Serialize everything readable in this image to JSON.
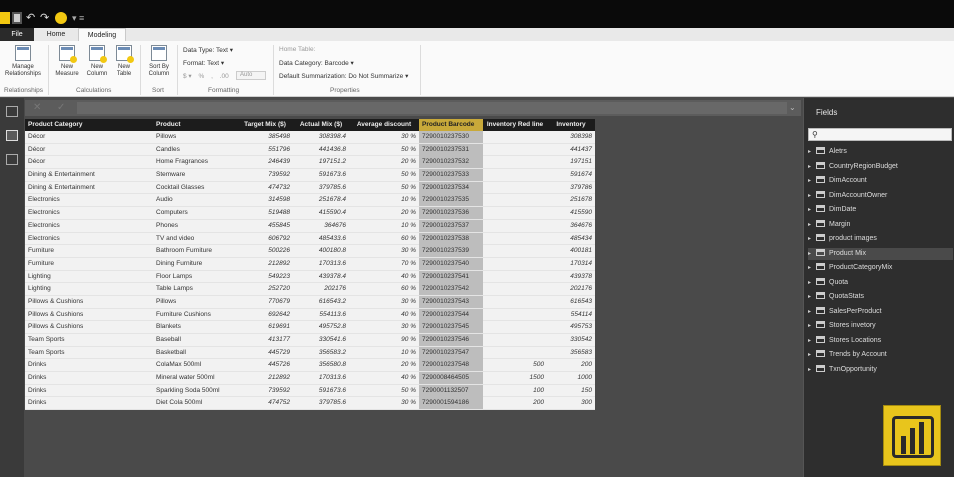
{
  "tabs": {
    "file": "File",
    "home": "Home",
    "modeling": "Modeling"
  },
  "ribbon": {
    "manage_relationships": "Manage Relationships",
    "relationships_group": "Relationships",
    "new_measure": "New Measure",
    "new_column": "New Column",
    "new_table": "New Table",
    "calculations_group": "Calculations",
    "sort_by_column": "Sort By Column",
    "sort_group": "Sort",
    "data_type": "Data Type: Text",
    "format": "Format: Text",
    "currency_symbol": "$",
    "percent_symbol": "%",
    "comma_symbol": ",",
    "auto": "Auto",
    "formatting_group": "Formatting",
    "home_table": "Home Table:",
    "data_category": "Data Category: Barcode",
    "default_summarization": "Default Summarization: Do Not Summarize",
    "properties_group": "Properties"
  },
  "icons": {
    "close": "close-icon",
    "check": "check-icon",
    "expand": "chevron-down-icon",
    "search": "search-icon",
    "table": "table-icon"
  },
  "table": {
    "columns": [
      "Product Category",
      "Product",
      "Target Mix ($)",
      "Actual Mix ($)",
      "Average discount",
      "Product Barcode",
      "Inventory Red line",
      "Inventory"
    ],
    "rows": [
      [
        "Décor",
        "Pillows",
        "385498",
        "308398.4",
        "30 %",
        "7290010237530",
        "",
        "308398"
      ],
      [
        "Décor",
        "Candles",
        "551796",
        "441436.8",
        "50 %",
        "7290010237531",
        "",
        "441437"
      ],
      [
        "Décor",
        "Home Fragrances",
        "246439",
        "197151.2",
        "20 %",
        "7290010237532",
        "",
        "197151"
      ],
      [
        "Dining & Entertainment",
        "Stemware",
        "739592",
        "591673.6",
        "50 %",
        "7290010237533",
        "",
        "591674"
      ],
      [
        "Dining & Entertainment",
        "Cocktail Glasses",
        "474732",
        "379785.6",
        "50 %",
        "7290010237534",
        "",
        "379786"
      ],
      [
        "Electronics",
        "Audio",
        "314598",
        "251678.4",
        "10 %",
        "7290010237535",
        "",
        "251678"
      ],
      [
        "Electronics",
        "Computers",
        "519488",
        "415590.4",
        "20 %",
        "7290010237536",
        "",
        "415590"
      ],
      [
        "Electronics",
        "Phones",
        "455845",
        "364676",
        "10 %",
        "7290010237537",
        "",
        "364676"
      ],
      [
        "Electronics",
        "TV and video",
        "606792",
        "485433.6",
        "60 %",
        "7290010237538",
        "",
        "485434"
      ],
      [
        "Furniture",
        "Bathroom Furniture",
        "500226",
        "400180.8",
        "30 %",
        "7290010237539",
        "",
        "400181"
      ],
      [
        "Furniture",
        "Dining Furniture",
        "212892",
        "170313.6",
        "70 %",
        "7290010237540",
        "",
        "170314"
      ],
      [
        "Lighting",
        "Floor Lamps",
        "549223",
        "439378.4",
        "40 %",
        "7290010237541",
        "",
        "439378"
      ],
      [
        "Lighting",
        "Table Lamps",
        "252720",
        "202176",
        "60 %",
        "7290010237542",
        "",
        "202176"
      ],
      [
        "Pillows & Cushions",
        "Pillows",
        "770679",
        "616543.2",
        "30 %",
        "7290010237543",
        "",
        "616543"
      ],
      [
        "Pillows & Cushions",
        "Furniture Cushions",
        "692642",
        "554113.6",
        "40 %",
        "7290010237544",
        "",
        "554114"
      ],
      [
        "Pillows & Cushions",
        "Blankets",
        "619691",
        "495752.8",
        "30 %",
        "7290010237545",
        "",
        "495753"
      ],
      [
        "Team Sports",
        "Baseball",
        "413177",
        "330541.6",
        "90 %",
        "7290010237546",
        "",
        "330542"
      ],
      [
        "Team Sports",
        "Basketball",
        "445729",
        "356583.2",
        "10 %",
        "7290010237547",
        "",
        "356583"
      ],
      [
        "Drinks",
        "ColaMax 500ml",
        "445726",
        "356580.8",
        "20 %",
        "7290010237548",
        "500",
        "200"
      ],
      [
        "Drinks",
        "Mineral water 500ml",
        "212892",
        "170313.6",
        "40 %",
        "7290008464505",
        "1500",
        "1000"
      ],
      [
        "Drinks",
        "Sparkling Soda 500ml",
        "739592",
        "591673.6",
        "50 %",
        "7290001132507",
        "100",
        "150"
      ],
      [
        "Drinks",
        "Diet Cola 500ml",
        "474752",
        "379785.6",
        "30 %",
        "7290001594186",
        "200",
        "300"
      ]
    ]
  },
  "fields": {
    "title": "Fields",
    "items": [
      "Aletrs",
      "CountryRegionBudget",
      "DimAccount",
      "DimAccountOwner",
      "DimDate",
      "Margin",
      "product images",
      "Product Mix",
      "ProductCategoryMix",
      "Quota",
      "QuotaStats",
      "SalesPerProduct",
      "Stores invetory",
      "Stores Locations",
      "Trends by Account",
      "TxnOpportunity"
    ],
    "active_index": 7
  }
}
